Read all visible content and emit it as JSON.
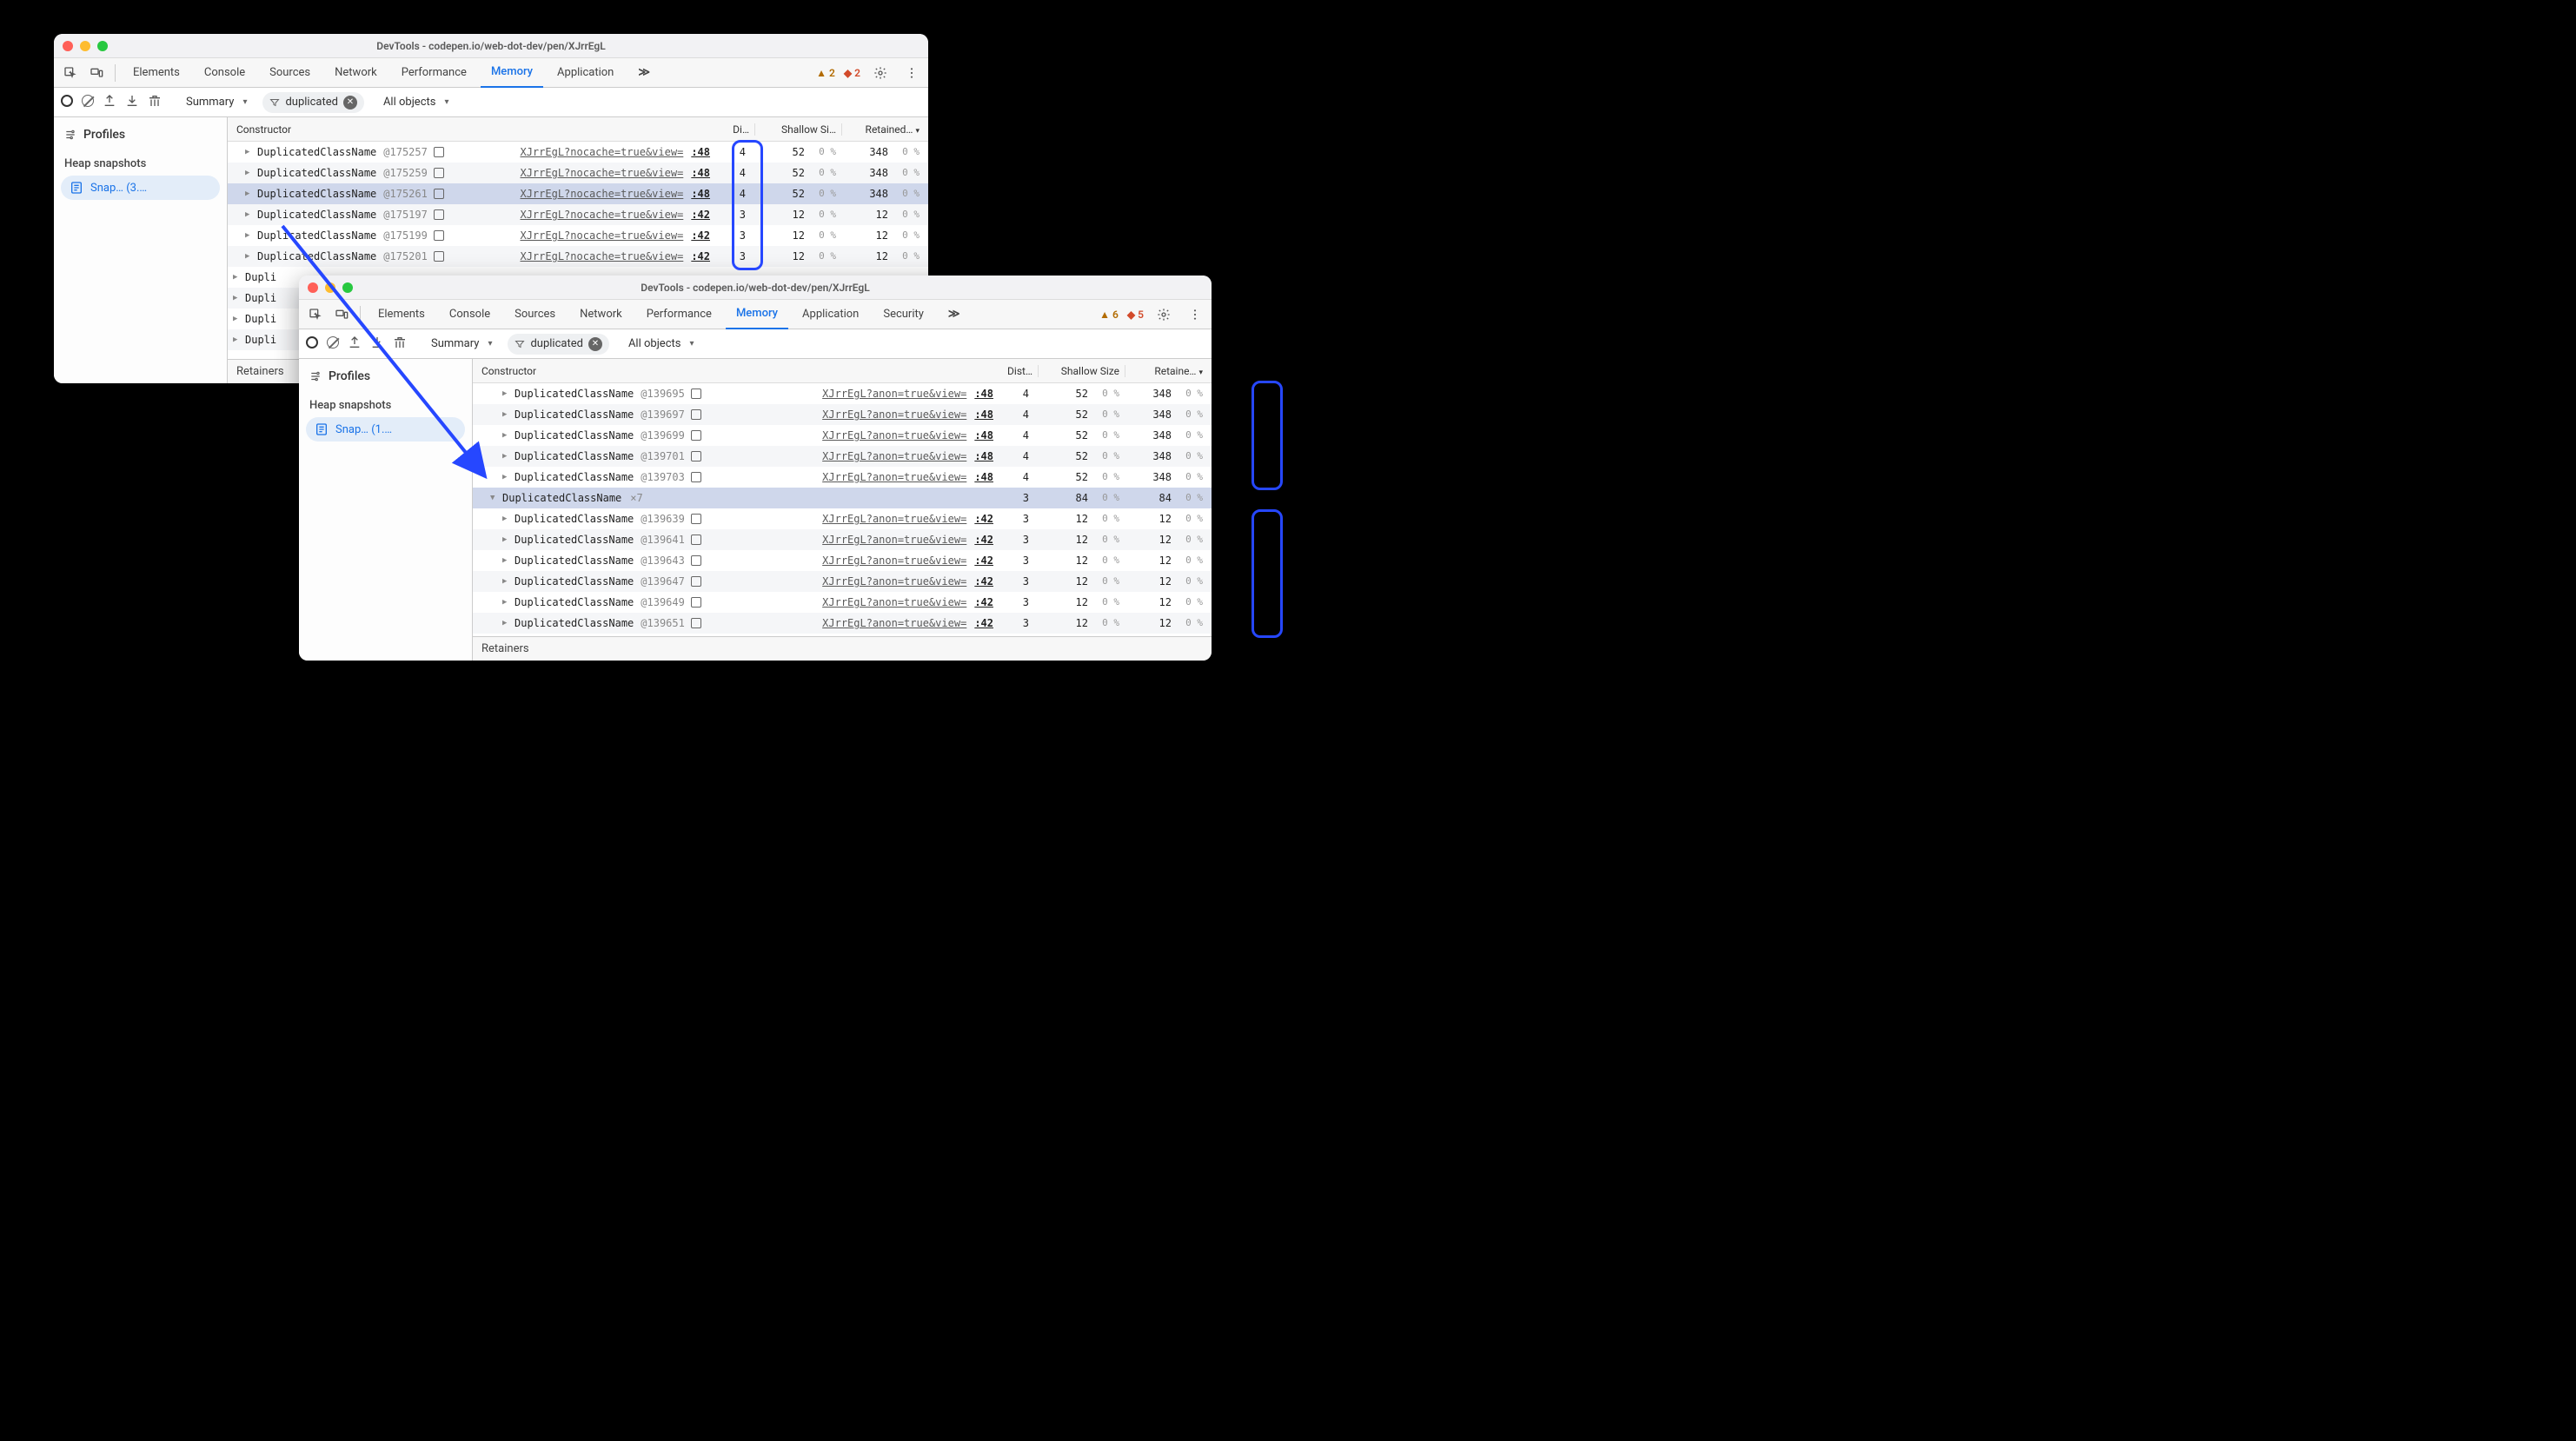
{
  "w1": {
    "title": "DevTools - codepen.io/web-dot-dev/pen/XJrrEgL",
    "tabs": [
      "Elements",
      "Console",
      "Sources",
      "Network",
      "Performance",
      "Memory",
      "Application"
    ],
    "activeTab": "Memory",
    "moreGlyph": "≫",
    "warnCount": "2",
    "issueCount": "2",
    "summary": "Summary",
    "filterText": "duplicated",
    "allObjects": "All objects",
    "sidebar": {
      "profiles": "Profiles",
      "heap": "Heap snapshots",
      "snap": "Snap…  (3.…"
    },
    "cols": {
      "constructor": "Constructor",
      "dist": "Di…",
      "shallow": "Shallow Si…",
      "retained": "Retained…"
    },
    "rows": [
      {
        "depth": 1,
        "name": "DuplicatedClassName",
        "id": "@175257",
        "src": "XJrrEgL?nocache=true&view=",
        "line": ":48",
        "dist": "4",
        "sh": "52",
        "ret": "348"
      },
      {
        "depth": 1,
        "name": "DuplicatedClassName",
        "id": "@175259",
        "src": "XJrrEgL?nocache=true&view=",
        "line": ":48",
        "dist": "4",
        "sh": "52",
        "ret": "348"
      },
      {
        "depth": 1,
        "name": "DuplicatedClassName",
        "id": "@175261",
        "src": "XJrrEgL?nocache=true&view=",
        "line": ":48",
        "dist": "4",
        "sh": "52",
        "ret": "348",
        "sel": true
      },
      {
        "depth": 1,
        "name": "DuplicatedClassName",
        "id": "@175197",
        "src": "XJrrEgL?nocache=true&view=",
        "line": ":42",
        "dist": "3",
        "sh": "12",
        "ret": "12"
      },
      {
        "depth": 1,
        "name": "DuplicatedClassName",
        "id": "@175199",
        "src": "XJrrEgL?nocache=true&view=",
        "line": ":42",
        "dist": "3",
        "sh": "12",
        "ret": "12"
      },
      {
        "depth": 1,
        "name": "DuplicatedClassName",
        "id": "@175201",
        "src": "XJrrEgL?nocache=true&view=",
        "line": ":42",
        "dist": "3",
        "sh": "12",
        "ret": "12"
      },
      {
        "depth": 0,
        "name": "Dupli",
        "partial": true
      },
      {
        "depth": 0,
        "name": "Dupli",
        "partial": true
      },
      {
        "depth": 0,
        "name": "Dupli",
        "partial": true
      },
      {
        "depth": 0,
        "name": "Dupli",
        "partial": true
      }
    ],
    "retainers": "Retainers"
  },
  "w2": {
    "title": "DevTools - codepen.io/web-dot-dev/pen/XJrrEgL",
    "tabs": [
      "Elements",
      "Console",
      "Sources",
      "Network",
      "Performance",
      "Memory",
      "Application",
      "Security"
    ],
    "activeTab": "Memory",
    "moreGlyph": "≫",
    "warnCount": "6",
    "issueCount": "5",
    "summary": "Summary",
    "filterText": "duplicated",
    "allObjects": "All objects",
    "sidebar": {
      "profiles": "Profiles",
      "heap": "Heap snapshots",
      "snap": "Snap…  (1.…"
    },
    "cols": {
      "constructor": "Constructor",
      "dist": "Dist…",
      "shallow": "Shallow Size",
      "retained": "Retaine…"
    },
    "rows": [
      {
        "depth": 2,
        "name": "DuplicatedClassName",
        "id": "@139695",
        "src": "XJrrEgL?anon=true&view=",
        "line": ":48",
        "dist": "4",
        "sh": "52",
        "ret": "348"
      },
      {
        "depth": 2,
        "name": "DuplicatedClassName",
        "id": "@139697",
        "src": "XJrrEgL?anon=true&view=",
        "line": ":48",
        "dist": "4",
        "sh": "52",
        "ret": "348"
      },
      {
        "depth": 2,
        "name": "DuplicatedClassName",
        "id": "@139699",
        "src": "XJrrEgL?anon=true&view=",
        "line": ":48",
        "dist": "4",
        "sh": "52",
        "ret": "348"
      },
      {
        "depth": 2,
        "name": "DuplicatedClassName",
        "id": "@139701",
        "src": "XJrrEgL?anon=true&view=",
        "line": ":48",
        "dist": "4",
        "sh": "52",
        "ret": "348"
      },
      {
        "depth": 2,
        "name": "DuplicatedClassName",
        "id": "@139703",
        "src": "XJrrEgL?anon=true&view=",
        "line": ":48",
        "dist": "4",
        "sh": "52",
        "ret": "348"
      },
      {
        "depth": 1,
        "open": true,
        "name": "DuplicatedClassName",
        "mult": "×7",
        "dist": "3",
        "sh": "84",
        "ret": "84",
        "sel": true
      },
      {
        "depth": 2,
        "name": "DuplicatedClassName",
        "id": "@139639",
        "src": "XJrrEgL?anon=true&view=",
        "line": ":42",
        "dist": "3",
        "sh": "12",
        "ret": "12"
      },
      {
        "depth": 2,
        "name": "DuplicatedClassName",
        "id": "@139641",
        "src": "XJrrEgL?anon=true&view=",
        "line": ":42",
        "dist": "3",
        "sh": "12",
        "ret": "12"
      },
      {
        "depth": 2,
        "name": "DuplicatedClassName",
        "id": "@139643",
        "src": "XJrrEgL?anon=true&view=",
        "line": ":42",
        "dist": "3",
        "sh": "12",
        "ret": "12"
      },
      {
        "depth": 2,
        "name": "DuplicatedClassName",
        "id": "@139647",
        "src": "XJrrEgL?anon=true&view=",
        "line": ":42",
        "dist": "3",
        "sh": "12",
        "ret": "12"
      },
      {
        "depth": 2,
        "name": "DuplicatedClassName",
        "id": "@139649",
        "src": "XJrrEgL?anon=true&view=",
        "line": ":42",
        "dist": "3",
        "sh": "12",
        "ret": "12"
      },
      {
        "depth": 2,
        "name": "DuplicatedClassName",
        "id": "@139651",
        "src": "XJrrEgL?anon=true&view=",
        "line": ":42",
        "dist": "3",
        "sh": "12",
        "ret": "12"
      }
    ],
    "retainers": "Retainers"
  },
  "pct": "0 %"
}
